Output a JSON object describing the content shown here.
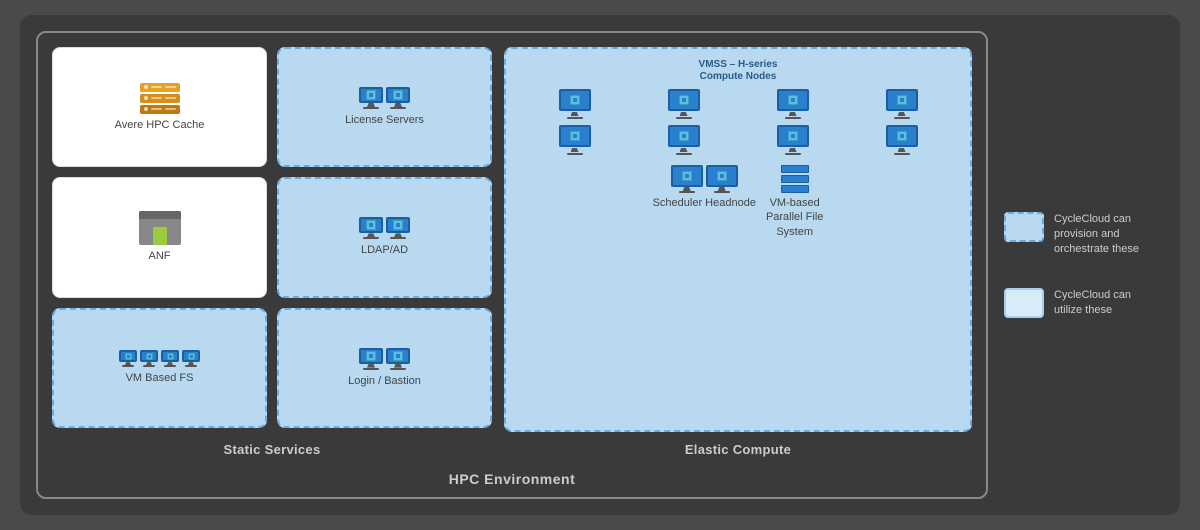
{
  "title": "HPC Environment",
  "legend": {
    "item1": {
      "label": "CycleCloud can provision and orchestrate these"
    },
    "item2": {
      "label": "CycleCloud can utilize these"
    }
  },
  "static_services": {
    "label": "Static Services",
    "cards": [
      {
        "id": "avere",
        "label": "Avere HPC Cache",
        "type": "white"
      },
      {
        "id": "license",
        "label": "License Servers",
        "type": "blue"
      },
      {
        "id": "anf",
        "label": "ANF",
        "type": "white"
      },
      {
        "id": "ldap",
        "label": "LDAP/AD",
        "type": "blue"
      },
      {
        "id": "vmfs",
        "label": "VM Based FS",
        "type": "blue"
      },
      {
        "id": "login",
        "label": "Login / Bastion",
        "type": "blue"
      }
    ]
  },
  "elastic_compute": {
    "label": "Elastic Compute",
    "vmss_label": "VMSS – H-series\nCompute Nodes",
    "scheduler_label": "Scheduler Headnode",
    "pfs_label": "VM-based\nParallel File\nSystem"
  }
}
